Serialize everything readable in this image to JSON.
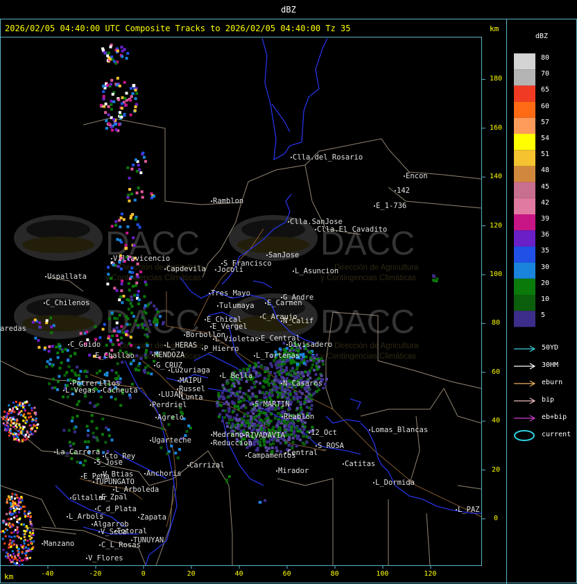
{
  "window": {
    "title": "dBZ"
  },
  "header": {
    "line": "2026/02/05 04:40:00 UTC Composite Tracks to 2026/02/05 04:40:00 Tz 35",
    "km_label": "km"
  },
  "axes": {
    "x_unit": "km",
    "y_unit": "km",
    "x_ticks": [
      -40,
      -20,
      0,
      20,
      40,
      60,
      80,
      100,
      120
    ],
    "y_ticks": [
      180,
      160,
      140,
      120,
      100,
      80,
      60,
      40,
      20,
      0
    ]
  },
  "legend": {
    "title": "dBZ",
    "scale": [
      {
        "label": "80",
        "color": "#d4d4d4"
      },
      {
        "label": "70",
        "color": "#b4b4b4"
      },
      {
        "label": "65",
        "color": "#f03a23"
      },
      {
        "label": "60",
        "color": "#ff6a14"
      },
      {
        "label": "57",
        "color": "#fc9b5a"
      },
      {
        "label": "54",
        "color": "#ffff00"
      },
      {
        "label": "51",
        "color": "#f5c230"
      },
      {
        "label": "48",
        "color": "#d1883d"
      },
      {
        "label": "45",
        "color": "#c86e8f"
      },
      {
        "label": "42",
        "color": "#e07aa0"
      },
      {
        "label": "39",
        "color": "#c81585"
      },
      {
        "label": "36",
        "color": "#6a1fc7"
      },
      {
        "label": "35",
        "color": "#2050e6"
      },
      {
        "label": "30",
        "color": "#1a84dc"
      },
      {
        "label": "20",
        "color": "#0a7a0a"
      },
      {
        "label": "10",
        "color": "#0b5e0b"
      },
      {
        "label": "5",
        "color": "#3d2d8a"
      }
    ],
    "tracks": [
      {
        "label": "50YD",
        "color": "#3fd0e0"
      },
      {
        "label": "30HM",
        "color": "#ffffff"
      },
      {
        "label": "eburn",
        "color": "#f0b060"
      },
      {
        "label": "bip",
        "color": "#f0c0c0"
      },
      {
        "label": "eb+bip",
        "color": "#d040d0"
      },
      {
        "label": "current",
        "color": "#30d0e0",
        "shape": "ellipse"
      }
    ]
  },
  "watermark": {
    "brand": "DACC",
    "line1": "Dirección de Agricultura",
    "line2": "y Contingencias Climáticas"
  },
  "map": {
    "cities": [
      {
        "name": "Clla.del_Rosario"
      },
      {
        "name": "Encon"
      },
      {
        "name": "142"
      },
      {
        "name": "E_1-736"
      },
      {
        "name": "Ramblon"
      },
      {
        "name": "Clla.SanJose"
      },
      {
        "name": "Clla.El_Cavadito"
      },
      {
        "name": "Villavicencio"
      },
      {
        "name": "S_Francisco"
      },
      {
        "name": "SanJose"
      },
      {
        "name": "Capdevila"
      },
      {
        "name": "Jocoli"
      },
      {
        "name": "L_Asuncion"
      },
      {
        "name": "Uspallata"
      },
      {
        "name": "Tres_Mayo"
      },
      {
        "name": "G_Andre"
      },
      {
        "name": "C_Chilenos"
      },
      {
        "name": "Tulumaya"
      },
      {
        "name": "E_Carmen"
      },
      {
        "name": "C_Araujo"
      },
      {
        "name": "E_Chical"
      },
      {
        "name": "N_Calif"
      },
      {
        "name": "aredas"
      },
      {
        "name": "E_Vergel"
      },
      {
        "name": "Borbollon"
      },
      {
        "name": "E_Central"
      },
      {
        "name": "L_Violetas"
      },
      {
        "name": "Divisadero"
      },
      {
        "name": "C_Guido"
      },
      {
        "name": "L_HERAS"
      },
      {
        "name": "P_Hierro"
      },
      {
        "name": "E_Challao"
      },
      {
        "name": "MENDOZA"
      },
      {
        "name": "L_Tortenas"
      },
      {
        "name": "G_CRUZ"
      },
      {
        "name": "Luzuriaga"
      },
      {
        "name": "L_Bella"
      },
      {
        "name": "Potrerillos"
      },
      {
        "name": "MAIPU"
      },
      {
        "name": "N_Casaros"
      },
      {
        "name": "L_Vegas"
      },
      {
        "name": "Cacheuta"
      },
      {
        "name": "Russel"
      },
      {
        "name": "LUJAN"
      },
      {
        "name": "Lunta"
      },
      {
        "name": "S_MARTIN"
      },
      {
        "name": "Perdriel"
      },
      {
        "name": "Agrelo"
      },
      {
        "name": "Reablon"
      },
      {
        "name": "Lomas_Blancas"
      },
      {
        "name": "12_Oct"
      },
      {
        "name": "Ugarteche"
      },
      {
        "name": "S_ROSA"
      },
      {
        "name": "La_Carrera"
      },
      {
        "name": "Cto_Rey"
      },
      {
        "name": "Medrano"
      },
      {
        "name": "Reduccion"
      },
      {
        "name": "RIVADAVIA"
      },
      {
        "name": "Campamentos"
      },
      {
        "name": "Central"
      },
      {
        "name": "S_Jose"
      },
      {
        "name": "Carrizal"
      },
      {
        "name": "Catitas"
      },
      {
        "name": "Anchoris"
      },
      {
        "name": "V_Btias"
      },
      {
        "name": "Mirador"
      },
      {
        "name": "E_Pena"
      },
      {
        "name": "TUPUNGATO"
      },
      {
        "name": "L_Dormida"
      },
      {
        "name": "L_Arboleda"
      },
      {
        "name": "Gltallar"
      },
      {
        "name": "E_Zpal"
      },
      {
        "name": "C_d_Plata"
      },
      {
        "name": "L_Arbols"
      },
      {
        "name": "Zapata"
      },
      {
        "name": "L_PAZ"
      },
      {
        "name": "Algarrob"
      },
      {
        "name": "V_Seca"
      },
      {
        "name": "Totoral"
      },
      {
        "name": "TUNUYAN"
      },
      {
        "name": "Manzano"
      },
      {
        "name": "C_L_Rosas"
      },
      {
        "name": "V_Flores"
      }
    ]
  }
}
